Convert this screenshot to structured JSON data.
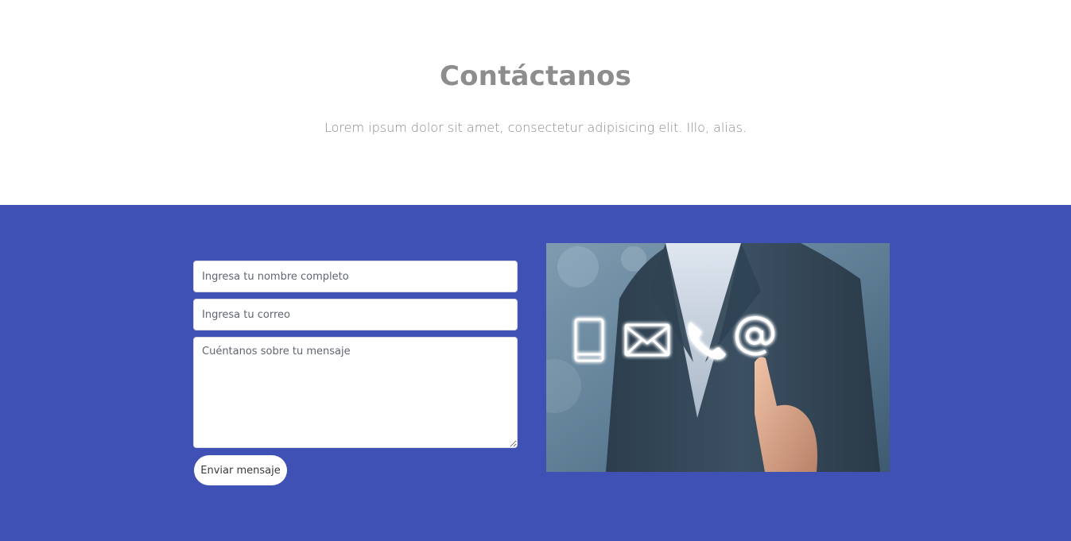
{
  "header": {
    "title": "Contáctanos",
    "subtitle": "Lorem ipsum dolor sit amet, consectetur adipisicing elit. Illo, alias."
  },
  "form": {
    "name_placeholder": "Ingresa tu nombre completo",
    "email_placeholder": "Ingresa tu correo",
    "message_placeholder": "Cuéntanos sobre tu mensaje",
    "submit_label": "Enviar mensaje"
  },
  "image": {
    "alt": "Ejecutivo tocando iconos de contacto",
    "icons": [
      "phone-device-icon",
      "envelope-icon",
      "telephone-handset-icon",
      "at-sign-icon"
    ]
  },
  "colors": {
    "band": "#4051b5",
    "title": "#8d8d8d",
    "subtitle": "#8a8a8a"
  }
}
